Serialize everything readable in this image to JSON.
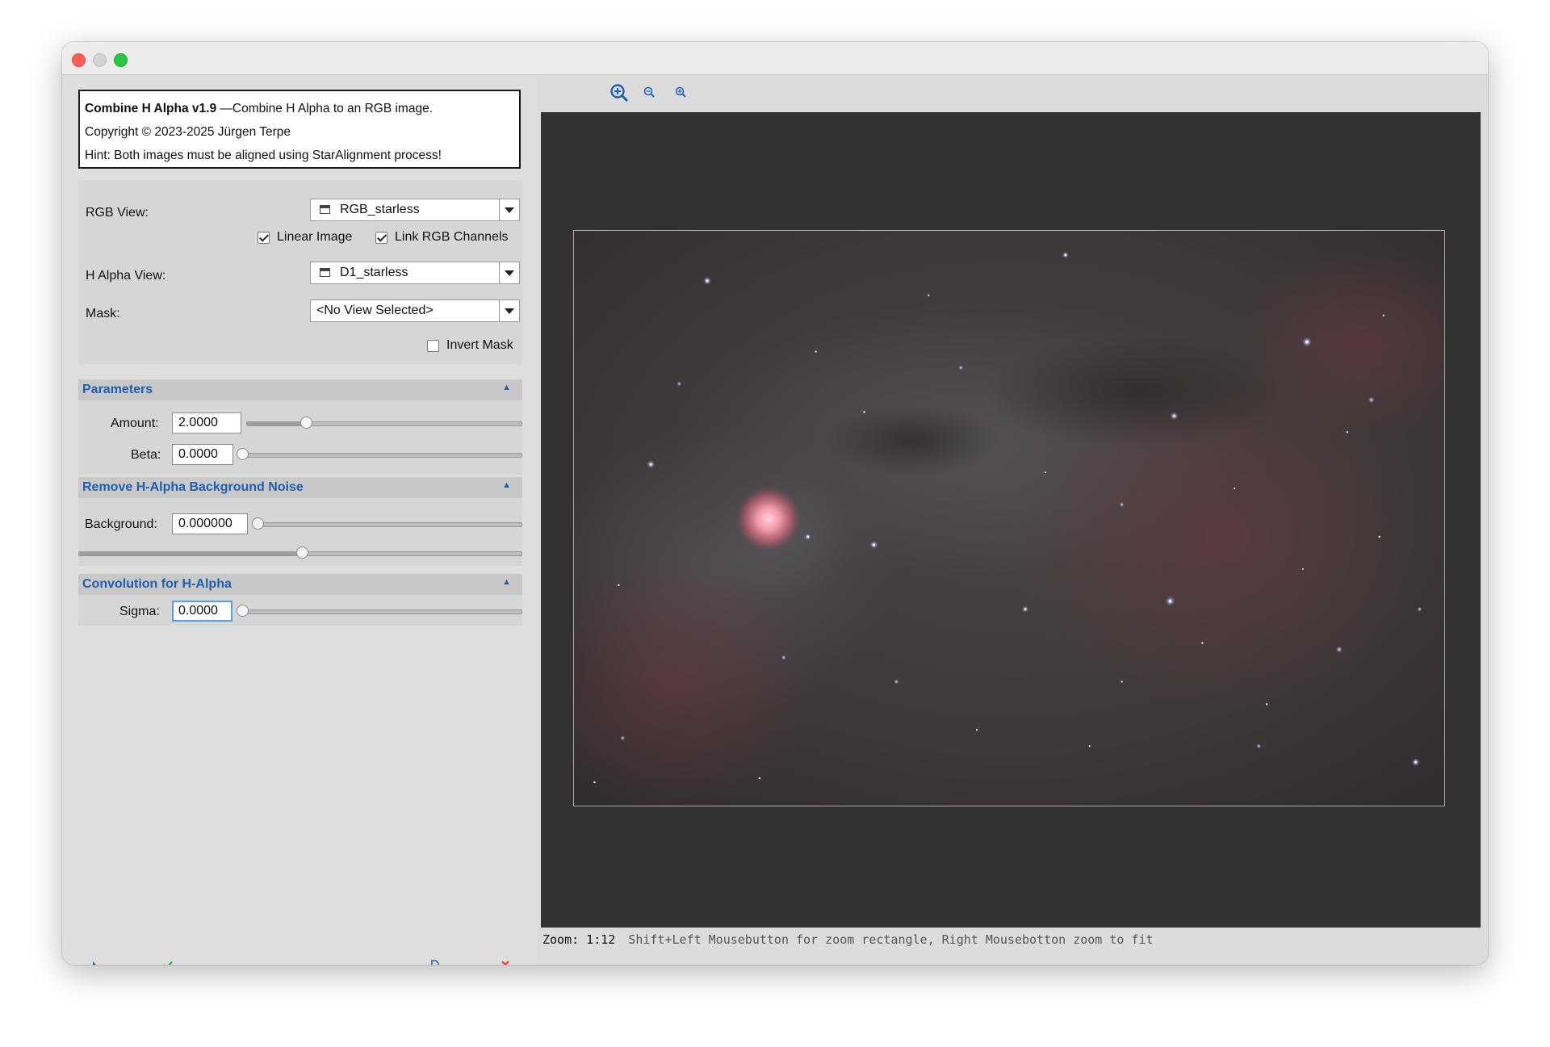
{
  "info": {
    "title_bold": "Combine H Alpha v1.9",
    "title_rest": " —Combine H Alpha to an RGB image.",
    "copyright": "Copyright © 2023-2025 Jürgen Terpe",
    "hint": "Hint: Both images must be aligned using StarAlignment process!"
  },
  "views": {
    "rgb_label": "RGB View:",
    "rgb_value": "RGB_starless",
    "linear_label": "Linear Image",
    "linear_checked": true,
    "link_label": "Link RGB Channels",
    "link_checked": true,
    "halpha_label": "H Alpha View:",
    "halpha_value": "D1_starless",
    "mask_label": "Mask:",
    "mask_value": "<No View Selected>",
    "invert_label": "Invert Mask",
    "invert_checked": false
  },
  "parameters": {
    "header": "Parameters",
    "amount_label": "Amount:",
    "amount_value": "2.0000",
    "amount_fraction": 0.21,
    "beta_label": "Beta:",
    "beta_value": "0.0000",
    "beta_fraction": 0.0
  },
  "noise": {
    "header": "Remove H-Alpha Background Noise",
    "background_label": "Background:",
    "background_value": "0.000000",
    "background_fraction": 0.0,
    "extra_slider_fraction": 0.5
  },
  "convolution": {
    "header": "Convolution for H-Alpha",
    "sigma_label": "Sigma:",
    "sigma_value": "0.0000",
    "sigma_fraction": 0.0
  },
  "status": {
    "zoom": "Zoom: 1:12",
    "hint": "Shift+Left Mousebutton for zoom rectangle, Right Mousebotton zoom to fit"
  },
  "icons": {
    "collapse": "collapse-arrow-icon",
    "zoom_fit": "zoom-fit-icon",
    "zoom_out": "zoom-out-icon",
    "zoom_in": "zoom-in-icon"
  },
  "colors": {
    "section_title": "#1f5fb0",
    "viewer_bg": "#323232",
    "close": "#ff5f57",
    "maximize": "#28c840",
    "reset_icon": "#e03030",
    "apply_icon": "#2a9a3a"
  }
}
